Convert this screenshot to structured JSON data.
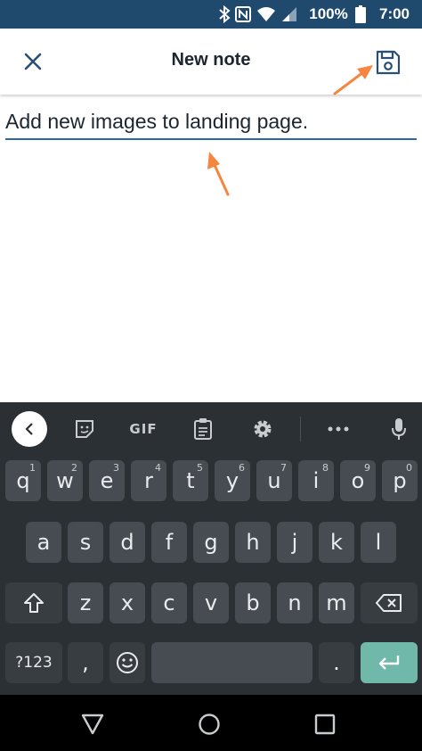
{
  "status_bar": {
    "battery_text": "100%",
    "time": "7:00",
    "icons": [
      "bluetooth-icon",
      "nfc-icon",
      "wifi-icon",
      "signal-icon",
      "battery-icon"
    ]
  },
  "app_bar": {
    "title": "New note",
    "close_icon": "close-icon",
    "save_icon": "save-icon"
  },
  "note": {
    "value": "Add new images to landing page."
  },
  "keyboard": {
    "toolbar": [
      "back-icon",
      "sticker-icon",
      "gif",
      "clipboard-icon",
      "settings-icon",
      "more-icon",
      "mic-icon"
    ],
    "gif_label": "GIF",
    "row1": [
      {
        "k": "q",
        "h": "1"
      },
      {
        "k": "w",
        "h": "2"
      },
      {
        "k": "e",
        "h": "3"
      },
      {
        "k": "r",
        "h": "4"
      },
      {
        "k": "t",
        "h": "5"
      },
      {
        "k": "y",
        "h": "6"
      },
      {
        "k": "u",
        "h": "7"
      },
      {
        "k": "i",
        "h": "8"
      },
      {
        "k": "o",
        "h": "9"
      },
      {
        "k": "p",
        "h": "0"
      }
    ],
    "row2": [
      "a",
      "s",
      "d",
      "f",
      "g",
      "h",
      "j",
      "k",
      "l"
    ],
    "row3": [
      "z",
      "x",
      "c",
      "v",
      "b",
      "n",
      "m"
    ],
    "symbols_label": "?123",
    "comma": ",",
    "period": ".",
    "accent_color": "#6fb8aa"
  },
  "nav_bar": {
    "buttons": [
      "back-triangle-icon",
      "home-circle-icon",
      "recents-square-icon"
    ]
  },
  "annotation": {
    "arrow_color": "#f5853f"
  }
}
